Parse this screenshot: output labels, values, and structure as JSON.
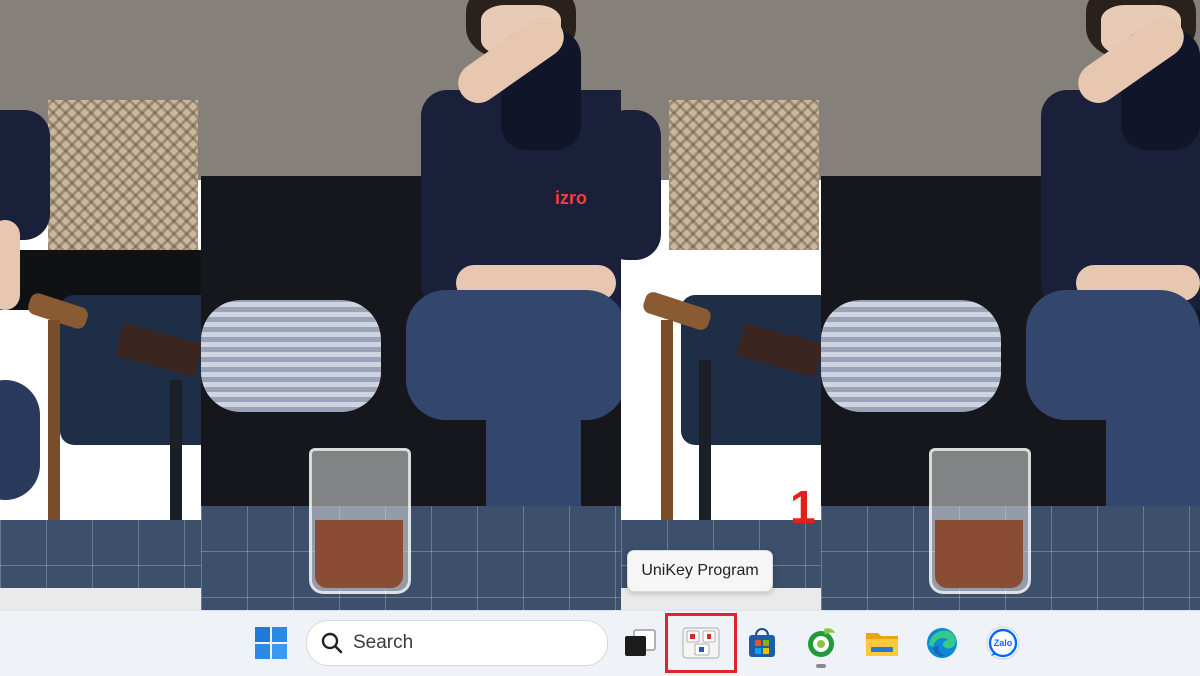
{
  "tooltip": {
    "text": "UniKey Program"
  },
  "annotation": {
    "step_number": "1",
    "color": "#e3211c"
  },
  "wallpaper": {
    "shirt_logo": "izro"
  },
  "taskbar": {
    "search": {
      "label": "Search"
    },
    "apps": [
      {
        "name": "Start",
        "icon": "windows-start-icon"
      },
      {
        "name": "Task View",
        "icon": "task-view-icon"
      },
      {
        "name": "UniKey Program",
        "icon": "unikey-icon",
        "highlighted": true
      },
      {
        "name": "Microsoft Store",
        "icon": "store-icon"
      },
      {
        "name": "Cốc Cốc",
        "icon": "coccoc-browser-icon",
        "running": true
      },
      {
        "name": "File Explorer",
        "icon": "folder-icon"
      },
      {
        "name": "Microsoft Edge",
        "icon": "edge-icon"
      },
      {
        "name": "Zalo",
        "icon": "zalo-icon",
        "label": "Zalo"
      }
    ]
  },
  "colors": {
    "highlight": "#e0242a",
    "windows_blue": "#1f7ad9"
  }
}
